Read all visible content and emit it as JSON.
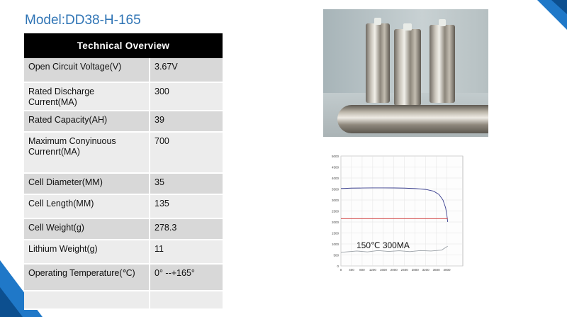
{
  "title": "Model:DD38-H-165",
  "table": {
    "header": "Technical  Overview",
    "rows": [
      {
        "label": "Open Circuit Voltage(V)",
        "value": "3.67V"
      },
      {
        "label": "Rated Discharge Current(MA)",
        "value": "300"
      },
      {
        "label": "Rated Capacity(AH)",
        "value": "39"
      },
      {
        "label": "Maximum Conyinuous Currenrt(MA)",
        "value": "700"
      },
      {
        "label": "Cell Diameter(MM)",
        "value": "35"
      },
      {
        "label": "Cell Length(MM)",
        "value": "135"
      },
      {
        "label": "Cell Weight(g)",
        "value": "278.3"
      },
      {
        "label": "Lithium Weight(g)",
        "value": "11"
      },
      {
        "label": "Operating Temperature(℃)",
        "value": "0° --+165°"
      },
      {
        "label": "",
        "value": ""
      }
    ]
  },
  "chart_data": {
    "type": "line",
    "annotation": "150℃  300MA",
    "x_ticks": [
      "0",
      "400",
      "800",
      "1200",
      "1600",
      "2000",
      "2400",
      "2800",
      "3200",
      "3600",
      "4000"
    ],
    "y_ticks": [
      "0",
      "500",
      "1000",
      "1500",
      "2000",
      "2500",
      "3000",
      "3500",
      "4000",
      "4500",
      "5000"
    ],
    "xlim": [
      0,
      4600
    ],
    "ylim": [
      0,
      5000
    ],
    "series": [
      {
        "color": "#3a3f8f",
        "x": [
          0,
          400,
          800,
          1200,
          1600,
          2000,
          2400,
          2800,
          3200,
          3500,
          3700,
          3850,
          3950,
          4000,
          4030
        ],
        "y": [
          3520,
          3540,
          3545,
          3550,
          3550,
          3548,
          3540,
          3520,
          3480,
          3400,
          3250,
          3000,
          2650,
          2300,
          2000
        ]
      },
      {
        "color": "#cc2a2a",
        "x": [
          0,
          4030
        ],
        "y": [
          2150,
          2150
        ]
      },
      {
        "color": "#9aa0a6",
        "x": [
          0,
          600,
          1000,
          1400,
          1800,
          2200,
          2600,
          3000,
          3400,
          3800,
          4030
        ],
        "y": [
          620,
          680,
          640,
          700,
          660,
          690,
          650,
          700,
          680,
          720,
          900
        ]
      }
    ]
  },
  "colors": {
    "accent": "#2f74b5",
    "header_bg": "#000000"
  }
}
